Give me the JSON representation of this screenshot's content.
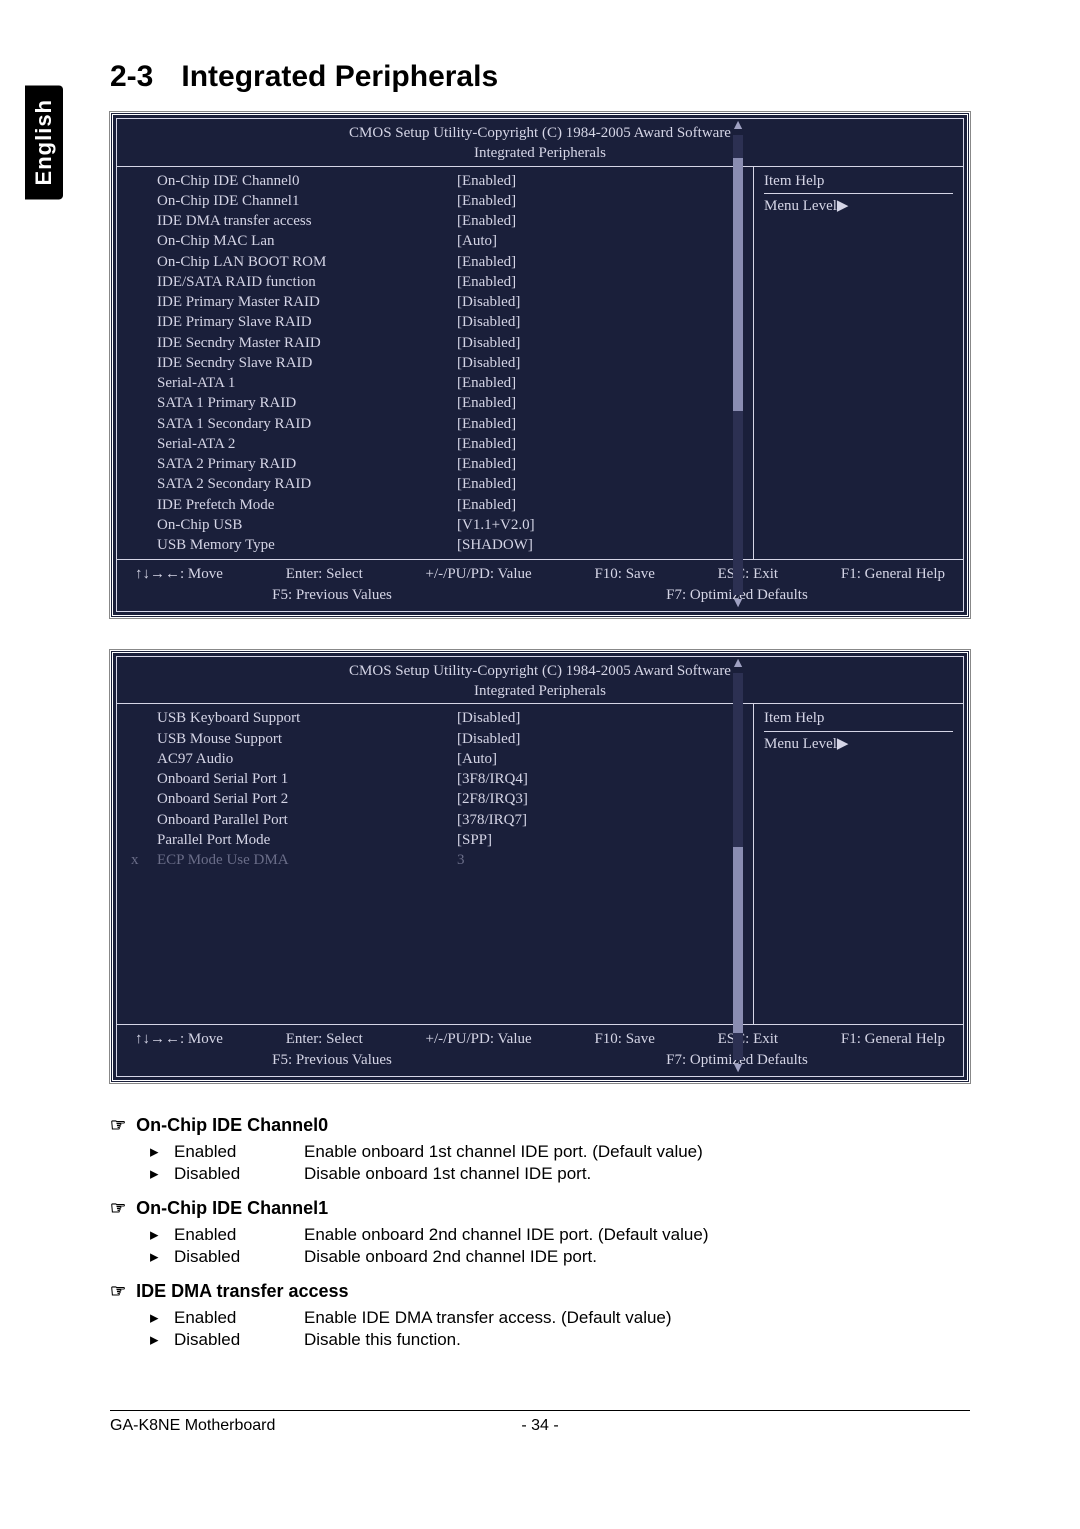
{
  "side_tab": "English",
  "section": {
    "number": "2-3",
    "title": "Integrated Peripherals"
  },
  "bios1": {
    "header_line1": "CMOS Setup Utility-Copyright (C) 1984-2005 Award Software",
    "header_line2": "Integrated Peripherals",
    "rows": [
      {
        "label": "On-Chip IDE Channel0",
        "value": "[Enabled]"
      },
      {
        "label": "On-Chip IDE Channel1",
        "value": "[Enabled]"
      },
      {
        "label": "IDE DMA transfer access",
        "value": "[Enabled]"
      },
      {
        "label": "On-Chip MAC Lan",
        "value": "[Auto]"
      },
      {
        "label": "On-Chip LAN BOOT ROM",
        "value": "[Enabled]"
      },
      {
        "label": "IDE/SATA RAID function",
        "value": "[Enabled]"
      },
      {
        "label": "IDE Primary Master RAID",
        "value": "[Disabled]"
      },
      {
        "label": "IDE Primary Slave RAID",
        "value": "[Disabled]"
      },
      {
        "label": "IDE Secndry Master RAID",
        "value": "[Disabled]"
      },
      {
        "label": "IDE Secndry Slave RAID",
        "value": "[Disabled]"
      },
      {
        "label": "Serial-ATA 1",
        "value": "[Enabled]"
      },
      {
        "label": "SATA 1 Primary RAID",
        "value": "[Enabled]"
      },
      {
        "label": "SATA 1 Secondary RAID",
        "value": "[Enabled]"
      },
      {
        "label": "Serial-ATA 2",
        "value": "[Enabled]"
      },
      {
        "label": "SATA 2 Primary RAID",
        "value": "[Enabled]"
      },
      {
        "label": "SATA 2 Secondary RAID",
        "value": "[Enabled]"
      },
      {
        "label": "IDE Prefetch Mode",
        "value": "[Enabled]"
      },
      {
        "label": "On-Chip USB",
        "value": "[V1.1+V2.0]"
      },
      {
        "label": "USB Memory Type",
        "value": "[SHADOW]"
      }
    ],
    "side": {
      "line1": "Item Help",
      "line2": "Menu Level▶"
    },
    "footer": {
      "move": "↑↓→←: Move",
      "select": "Enter: Select",
      "value": "+/-/PU/PD: Value",
      "save": "F10: Save",
      "exit": "ESC: Exit",
      "help": "F1: General Help",
      "prev": "F5: Previous Values",
      "opt": "F7: Optimized Defaults"
    },
    "thumb": {
      "top_pct": 5,
      "height_pct": 55
    }
  },
  "bios2": {
    "header_line1": "CMOS Setup Utility-Copyright (C) 1984-2005 Award Software",
    "header_line2": "Integrated Peripherals",
    "rows": [
      {
        "label": "USB Keyboard Support",
        "value": "[Disabled]"
      },
      {
        "label": "USB Mouse Support",
        "value": "[Disabled]"
      },
      {
        "label": "AC97 Audio",
        "value": "[Auto]"
      },
      {
        "label": "Onboard Serial Port 1",
        "value": "[3F8/IRQ4]"
      },
      {
        "label": "Onboard Serial Port 2",
        "value": "[2F8/IRQ3]"
      },
      {
        "label": "Onboard Parallel Port",
        "value": "[378/IRQ7]"
      },
      {
        "label": "Parallel Port Mode",
        "value": "[SPP]"
      },
      {
        "label": "ECP Mode Use DMA",
        "value": "3",
        "disabled": true,
        "x": "x"
      }
    ],
    "side": {
      "line1": "Item Help",
      "line2": "Menu Level▶"
    },
    "footer": {
      "move": "↑↓→←: Move",
      "select": "Enter: Select",
      "value": "+/-/PU/PD: Value",
      "save": "F10: Save",
      "exit": "ESC: Exit",
      "help": "F1: General Help",
      "prev": "F5: Previous Values",
      "opt": "F7: Optimized Defaults"
    },
    "thumb": {
      "top_pct": 45,
      "height_pct": 48
    }
  },
  "descriptions": [
    {
      "heading": "On-Chip IDE Channel0",
      "options": [
        {
          "name": "Enabled",
          "text": "Enable onboard 1st channel IDE port. (Default value)"
        },
        {
          "name": "Disabled",
          "text": "Disable onboard 1st channel IDE port."
        }
      ]
    },
    {
      "heading": "On-Chip IDE Channel1",
      "options": [
        {
          "name": "Enabled",
          "text": "Enable onboard 2nd channel IDE port. (Default value)"
        },
        {
          "name": "Disabled",
          "text": "Disable onboard 2nd channel IDE port."
        }
      ]
    },
    {
      "heading": "IDE DMA transfer access",
      "options": [
        {
          "name": "Enabled",
          "text": "Enable IDE DMA transfer access. (Default value)"
        },
        {
          "name": "Disabled",
          "text": "Disable this function."
        }
      ]
    }
  ],
  "icons": {
    "hand": "☞",
    "tri": "▸"
  },
  "footer": {
    "left": "GA-K8NE Motherboard",
    "center": "- 34 -"
  }
}
